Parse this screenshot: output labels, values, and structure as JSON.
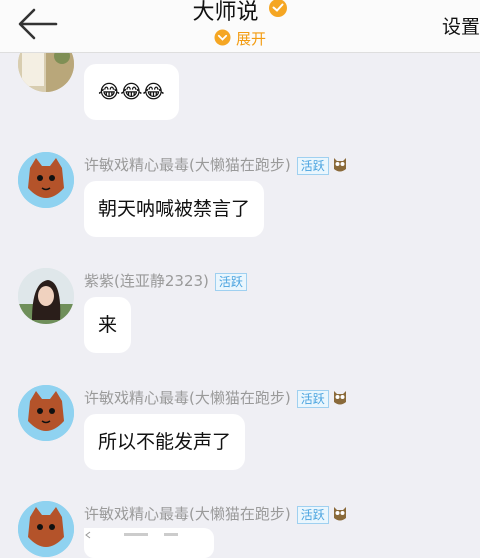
{
  "header": {
    "title": "大师说",
    "expand_label": "展开",
    "settings_label": "设置"
  },
  "tags": {
    "active": "活跃"
  },
  "messages": [
    {
      "name": "",
      "text": "😂😂😂"
    },
    {
      "name": "许敏戏精心最毒(大懒猫在跑步)",
      "text": "朝天呐喊被禁言了"
    },
    {
      "name": "紫紫(连亚静2323)",
      "text": "来"
    },
    {
      "name": "许敏戏精心最毒(大懒猫在跑步)",
      "text": "所以不能发声了"
    },
    {
      "name": "许敏戏精心最毒(大懒猫在跑步)",
      "text": ""
    }
  ],
  "colors": {
    "accent": "#f39c12",
    "tag": "#4aa3df",
    "bubble": "#ffffff",
    "background": "#efeff4"
  }
}
